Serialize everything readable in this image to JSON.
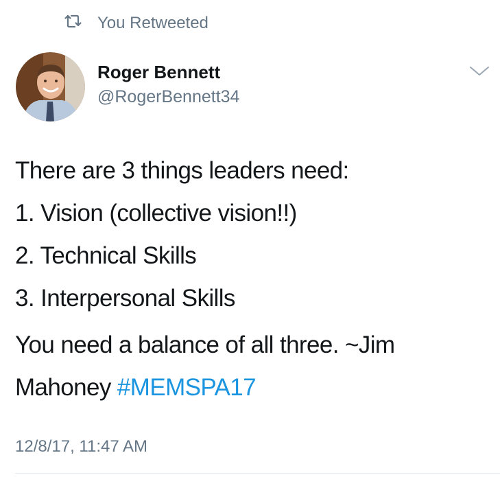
{
  "social_context": {
    "text": "You Retweeted",
    "icon": "retweet-icon"
  },
  "author": {
    "display_name": "Roger Bennett",
    "handle": "@RogerBennett34",
    "avatar_icon": "profile-photo"
  },
  "tweet": {
    "lines": [
      "There are 3 things leaders need:",
      "1. Vision (collective vision!!)",
      "2. Technical Skills",
      "3. Interpersonal Skills"
    ],
    "closing_line1": "You need a balance of all three.  ~Jim",
    "closing_line2_text": "Mahoney ",
    "hashtag": "#MEMSPA17",
    "timestamp": "12/8/17, 11:47 AM"
  },
  "colors": {
    "link": "#1b95e0",
    "secondary_text": "#657786",
    "primary_text": "#14171a"
  }
}
